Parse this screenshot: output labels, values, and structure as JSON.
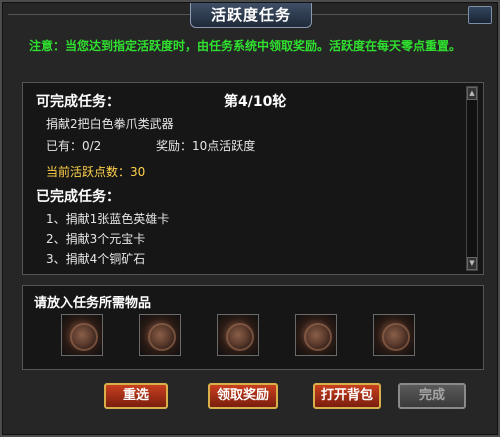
{
  "window": {
    "title": "活跃度任务"
  },
  "notice": "注意：当您达到指定活跃度时，由任务系统中领取奖励。活跃度在每天零点重置。",
  "task_panel": {
    "available_label": "可完成任务：",
    "round": "第4/10轮",
    "task_desc": "捐献2把白色拳爪类武器",
    "have": "已有：0/2",
    "reward": "奖励：10点活跃度",
    "current_points": "当前活跃点数：30",
    "completed_label": "已完成任务：",
    "completed": [
      "1、捐献1张蓝色英雄卡",
      "2、捐献3个元宝卡",
      "3、捐献4个铜矿石"
    ]
  },
  "items_panel": {
    "label": "请放入任务所需物品",
    "slots": [
      "item-slot",
      "item-slot",
      "item-slot",
      "item-slot",
      "item-slot"
    ]
  },
  "buttons": {
    "reselect": "重选",
    "claim": "领取奖励",
    "open_bag": "打开背包",
    "complete": "完成"
  },
  "colors": {
    "notice": "#2fe02f",
    "highlight": "#ffd24a",
    "button": "#c9401f",
    "button_border": "#d7b04a"
  }
}
